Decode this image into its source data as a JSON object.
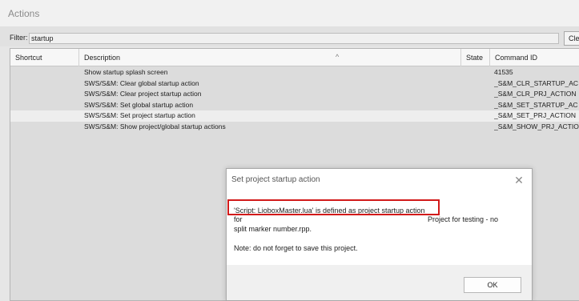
{
  "window": {
    "title": "Actions"
  },
  "filter": {
    "label": "Filter:",
    "value": "startup",
    "clear_label": "Clea"
  },
  "columns": {
    "shortcut": "Shortcut",
    "description": "Description",
    "state": "State",
    "command_id": "Command ID",
    "sort_indicator": "^"
  },
  "rows": [
    {
      "description": "Show startup splash screen",
      "command_id": "41535"
    },
    {
      "description": "SWS/S&M: Clear global startup action",
      "command_id": "_S&M_CLR_STARTUP_AC"
    },
    {
      "description": "SWS/S&M: Clear project startup action",
      "command_id": "_S&M_CLR_PRJ_ACTION"
    },
    {
      "description": "SWS/S&M: Set global startup action",
      "command_id": "_S&M_SET_STARTUP_AC"
    },
    {
      "description": "SWS/S&M: Set project startup action",
      "command_id": "_S&M_SET_PRJ_ACTION",
      "selected": true
    },
    {
      "description": "SWS/S&M: Show project/global startup actions",
      "command_id": "_S&M_SHOW_PRJ_ACTIO"
    }
  ],
  "dialog": {
    "title": "Set project startup action",
    "line1": "'Script: LioboxMaster.lua' is defined as project startup action",
    "line2_left": "for",
    "line2_right": "Project for testing - no",
    "line3": "split marker number.rpp.",
    "note": "Note: do not forget to save this project.",
    "ok_label": "OK",
    "close_glyph": "✕"
  },
  "colors": {
    "highlight": "#d21a1a",
    "selected_row": "#eeeeee"
  }
}
